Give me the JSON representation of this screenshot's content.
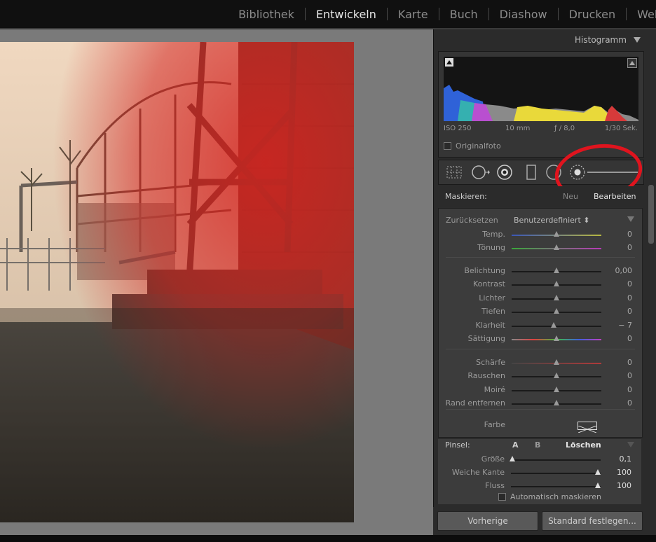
{
  "modules": {
    "items": [
      "Bibliothek",
      "Entwickeln",
      "Karte",
      "Buch",
      "Diashow",
      "Drucken",
      "Web"
    ],
    "active": "Entwickeln"
  },
  "histogram": {
    "title": "Histogramm",
    "exif": {
      "iso": "ISO 250",
      "focal": "10 mm",
      "aperture": "ƒ / 8,0",
      "shutter": "1/30 Sek."
    },
    "original_label": "Originalfoto"
  },
  "mask": {
    "label": "Maskieren:",
    "new": "Neu",
    "edit": "Bearbeiten"
  },
  "adjustments": {
    "reset": "Zurücksetzen",
    "preset": "Benutzerdefiniert ⬍",
    "groups": [
      [
        {
          "label": "Temp.",
          "value": "0",
          "position": 0.5,
          "track": "temp"
        },
        {
          "label": "Tönung",
          "value": "0",
          "position": 0.5,
          "track": "tint"
        }
      ],
      [
        {
          "label": "Belichtung",
          "value": "0,00",
          "position": 0.5,
          "track": "plain"
        },
        {
          "label": "Kontrast",
          "value": "0",
          "position": 0.5,
          "track": "plain"
        },
        {
          "label": "Lichter",
          "value": "0",
          "position": 0.5,
          "track": "plain"
        },
        {
          "label": "Tiefen",
          "value": "0",
          "position": 0.5,
          "track": "plain"
        },
        {
          "label": "Klarheit",
          "value": "− 7",
          "position": 0.465,
          "track": "plain"
        },
        {
          "label": "Sättigung",
          "value": "0",
          "position": 0.5,
          "track": "sat"
        }
      ],
      [
        {
          "label": "Schärfe",
          "value": "0",
          "position": 0.5,
          "track": "red"
        },
        {
          "label": "Rauschen",
          "value": "0",
          "position": 0.5,
          "track": "plain"
        },
        {
          "label": "Moiré",
          "value": "0",
          "position": 0.5,
          "track": "plain"
        },
        {
          "label": "Rand entfernen",
          "value": "0",
          "position": 0.5,
          "track": "plain"
        }
      ]
    ],
    "color_label": "Farbe"
  },
  "brush": {
    "label": "Pinsel:",
    "a": "A",
    "b": "B",
    "erase": "Löschen",
    "rows": [
      {
        "label": "Größe",
        "value": "0,1",
        "position": 0.02
      },
      {
        "label": "Weiche Kante",
        "value": "100",
        "position": 1.0
      },
      {
        "label": "Fluss",
        "value": "100",
        "position": 1.0
      }
    ],
    "auto_mask": "Automatisch maskieren"
  },
  "buttons": {
    "previous": "Vorherige",
    "set_default": "Standard festlegen..."
  },
  "colors": {
    "accent_red": "#e0141e",
    "mask_overlay": "#d4231f",
    "panel_bg": "#2b2b2b",
    "panel_inner": "#3c3c3c"
  }
}
